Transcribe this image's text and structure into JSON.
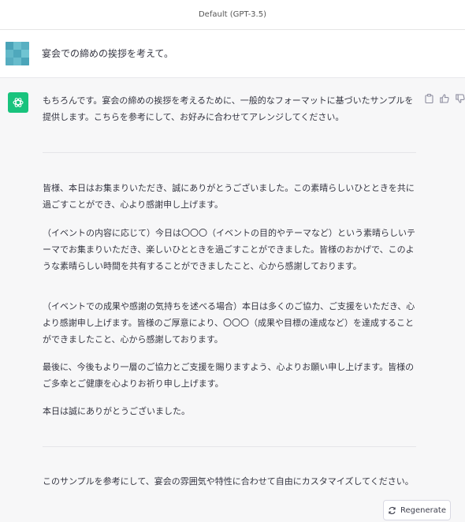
{
  "header": {
    "model_label": "Default (GPT-3.5)"
  },
  "user_message": {
    "text": "宴会での締めの挨拶を考えて。"
  },
  "assistant": {
    "intro": "もちろんです。宴会の締めの挨拶を考えるために、一般的なフォーマットに基づいたサンプルを提供します。こちらを参考にして、お好みに合わせてアレンジしてください。",
    "paragraphs": [
      "皆様、本日はお集まりいただき、誠にありがとうございました。この素晴らしいひとときを共に過ごすことができ、心より感謝申し上げます。",
      "（イベントの内容に応じて）今日は〇〇〇（イベントの目的やテーマなど）という素晴らしいテーマでお集まりいただき、楽しいひとときを過ごすことができました。皆様のおかげで、このような素晴らしい時間を共有することができましたこと、心から感謝しております。",
      "（イベントでの成果や感謝の気持ちを述べる場合）本日は多くのご協力、ご支援をいただき、心より感謝申し上げます。皆様のご厚意により、〇〇〇（成果や目標の達成など）を達成することができましたこと、心から感謝しております。",
      "最後に、今後もより一層のご協力とご支援を賜りますよう、心よりお願い申し上げます。皆様のご多幸とご健康を心よりお祈り申し上げます。",
      "本日は誠にありがとうございました。"
    ],
    "closing": "このサンプルを参考にして、宴会の雰囲気や特性に合わせて自由にカスタマイズしてください。"
  },
  "icons": {
    "assistant_avatar": "openai-logo-icon",
    "copy": "clipboard-icon",
    "like": "thumbs-up-icon",
    "dislike": "thumbs-down-icon",
    "regenerate": "refresh-icon"
  },
  "regenerate_button": {
    "label": "Regenerate"
  },
  "colors": {
    "accent": "#19c37d",
    "assistant_bg": "#f7f7f8",
    "user_avatar": "#5fb2c3"
  }
}
